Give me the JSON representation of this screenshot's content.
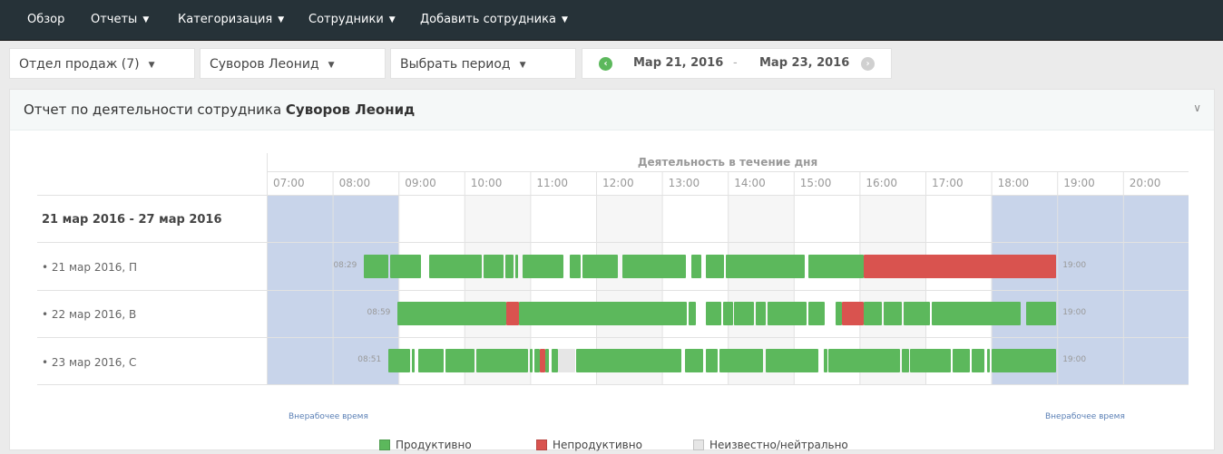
{
  "nav": {
    "items": [
      {
        "label": "Обзор",
        "caret": false
      },
      {
        "label": "Отчеты",
        "caret": true
      },
      {
        "label": "Категоризация",
        "caret": true
      },
      {
        "label": "Сотрудники",
        "caret": true
      },
      {
        "label": "Добавить сотрудника",
        "caret": true
      }
    ]
  },
  "filters": {
    "department": "Отдел продаж (7)",
    "employee": "Суворов Леонид",
    "period": "Выбрать период",
    "date_from": "Мар 21, 2016",
    "date_sep": "-",
    "date_to": "Мар 23, 2016"
  },
  "panel": {
    "title_prefix": "Отчет по деятельности сотрудника",
    "title_name": "Суворов Леонид"
  },
  "chart_data": {
    "type": "table",
    "title": "Деятельность в течение дня",
    "hours": [
      "07:00",
      "08:00",
      "09:00",
      "10:00",
      "11:00",
      "12:00",
      "13:00",
      "14:00",
      "15:00",
      "16:00",
      "17:00",
      "18:00",
      "19:00",
      "20:00"
    ],
    "range_label": "21 мар 2016 - 27 мар 2016",
    "workday": {
      "start": 9,
      "end": 18
    },
    "off_hours_label": "Внерабочее время",
    "axis": {
      "start": 7,
      "end": 21
    },
    "rows": [
      {
        "label": "• 21 мар 2016, П",
        "start_label": "08:29",
        "end_label": "19:00",
        "segments": [
          [
            8.48,
            8.85,
            "p"
          ],
          [
            8.88,
            9.34,
            "p"
          ],
          [
            9.46,
            10.27,
            "p"
          ],
          [
            10.29,
            10.6,
            "p"
          ],
          [
            10.62,
            10.75,
            "p"
          ],
          [
            10.78,
            10.82,
            "p"
          ],
          [
            10.88,
            11.5,
            "p"
          ],
          [
            11.6,
            11.77,
            "p"
          ],
          [
            11.8,
            12.33,
            "p"
          ],
          [
            12.4,
            13.37,
            "p"
          ],
          [
            13.44,
            13.6,
            "p"
          ],
          [
            13.66,
            13.94,
            "p"
          ],
          [
            13.97,
            15.17,
            "p"
          ],
          [
            15.22,
            16.07,
            "p"
          ],
          [
            16.07,
            18.99,
            "u"
          ]
        ]
      },
      {
        "label": "• 22 мар 2016, В",
        "start_label": "08:59",
        "end_label": "19:00",
        "segments": [
          [
            8.99,
            10.63,
            "p"
          ],
          [
            10.63,
            10.83,
            "u"
          ],
          [
            10.83,
            13.38,
            "p"
          ],
          [
            13.41,
            13.52,
            "p"
          ],
          [
            13.67,
            13.9,
            "p"
          ],
          [
            13.93,
            14.08,
            "p"
          ],
          [
            14.1,
            14.4,
            "p"
          ],
          [
            14.43,
            14.57,
            "p"
          ],
          [
            14.6,
            15.2,
            "p"
          ],
          [
            15.22,
            15.47,
            "p"
          ],
          [
            15.63,
            15.73,
            "p"
          ],
          [
            15.73,
            16.07,
            "u"
          ],
          [
            16.07,
            16.34,
            "p"
          ],
          [
            16.37,
            16.64,
            "p"
          ],
          [
            16.67,
            17.07,
            "p"
          ],
          [
            17.1,
            18.45,
            "p"
          ],
          [
            18.53,
            18.99,
            "p"
          ]
        ]
      },
      {
        "label": "• 23 мар 2016, С",
        "start_label": "08:51",
        "end_label": "19:00",
        "segments": [
          [
            8.85,
            9.17,
            "p"
          ],
          [
            9.2,
            9.25,
            "p"
          ],
          [
            9.3,
            9.68,
            "p"
          ],
          [
            9.71,
            10.15,
            "p"
          ],
          [
            10.18,
            10.97,
            "p"
          ],
          [
            11.0,
            11.04,
            "p"
          ],
          [
            11.07,
            11.14,
            "p"
          ],
          [
            11.14,
            11.23,
            "u"
          ],
          [
            11.23,
            11.29,
            "p"
          ],
          [
            11.32,
            11.42,
            "p"
          ],
          [
            11.42,
            11.69,
            "n"
          ],
          [
            11.7,
            13.29,
            "p"
          ],
          [
            13.35,
            13.62,
            "p"
          ],
          [
            13.67,
            13.84,
            "p"
          ],
          [
            13.87,
            14.54,
            "p"
          ],
          [
            14.57,
            15.38,
            "p"
          ],
          [
            15.46,
            15.51,
            "p"
          ],
          [
            15.53,
            16.62,
            "p"
          ],
          [
            16.64,
            16.75,
            "p"
          ],
          [
            16.77,
            17.39,
            "p"
          ],
          [
            17.42,
            17.68,
            "p"
          ],
          [
            17.7,
            17.9,
            "p"
          ],
          [
            17.93,
            17.98,
            "p"
          ],
          [
            18.0,
            18.99,
            "p"
          ]
        ]
      }
    ],
    "legend": [
      {
        "key": "p",
        "label": "Продуктивно",
        "color": "#5cb85c"
      },
      {
        "key": "u",
        "label": "Непродуктивно",
        "color": "#d9534f"
      },
      {
        "key": "n",
        "label": "Неизвестно/нейтрально",
        "color": "#e6e6e6"
      }
    ]
  },
  "colors": {
    "navbar": "#263238",
    "off_hours": "#c8d4ea",
    "productive": "#5cb85c",
    "unproductive": "#d9534f",
    "neutral": "#e6e6e6",
    "nav_prev": "#5cb85c",
    "nav_next": "#d0d0d0"
  }
}
